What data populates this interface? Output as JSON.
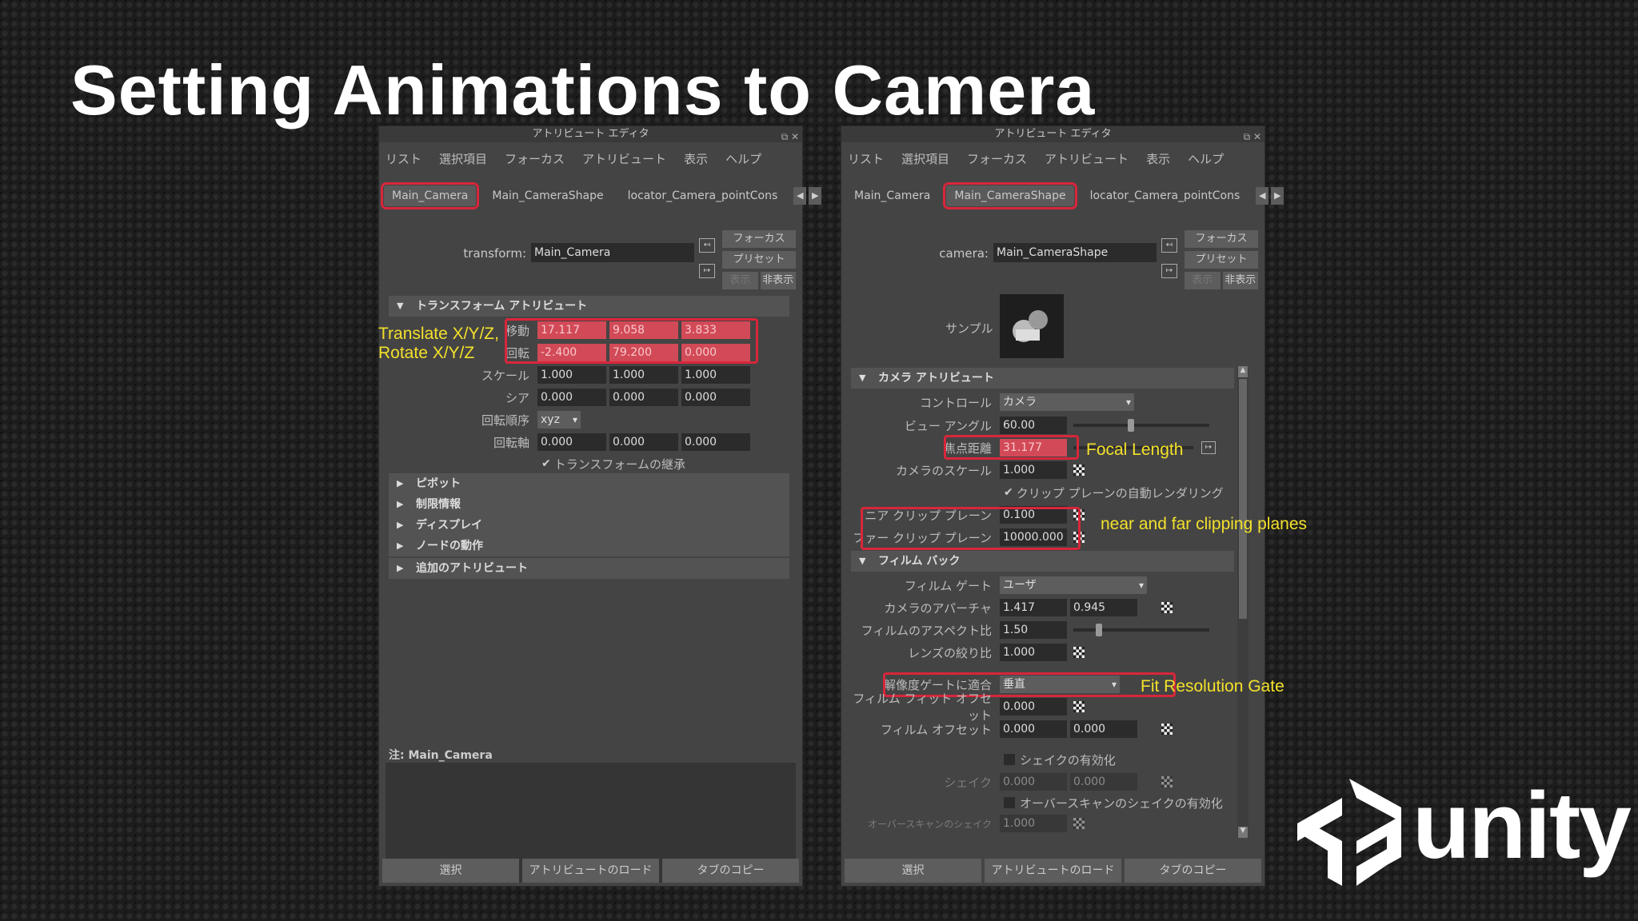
{
  "slide": {
    "title": "Setting Animations to Camera"
  },
  "left_editor": {
    "window_title": "アトリビュート エディタ",
    "menu": [
      "リスト",
      "選択項目",
      "フォーカス",
      "アトリビュート",
      "表示",
      "ヘルプ"
    ],
    "tabs": [
      "Main_Camera",
      "Main_CameraShape",
      "locator_Camera_pointCons"
    ],
    "node_type_label": "transform:",
    "node_name": "Main_Camera",
    "side_buttons": {
      "focus": "フォーカス",
      "preset": "プリセット",
      "show": "表示",
      "hide": "非表示"
    },
    "section_title": "トランスフォーム アトリビュート",
    "rows": [
      {
        "label": "移動",
        "values": [
          "17.117",
          "9.058",
          "3.833"
        ]
      },
      {
        "label": "回転",
        "values": [
          "-2.400",
          "79.200",
          "0.000"
        ]
      },
      {
        "label": "スケール",
        "values": [
          "1.000",
          "1.000",
          "1.000"
        ]
      },
      {
        "label": "シア",
        "values": [
          "0.000",
          "0.000",
          "0.000"
        ]
      },
      {
        "label": "回転順序",
        "values": [
          "xyz"
        ]
      },
      {
        "label": "回転軸",
        "values": [
          "0.000",
          "0.000",
          "0.000"
        ]
      }
    ],
    "inherit_label": "トランスフォームの継承",
    "collapsed_sections": [
      "ピボット",
      "制限情報",
      "ディスプレイ",
      "ノードの動作",
      "追加のアトリビュート"
    ],
    "note_label": "注:  Main_Camera",
    "bottom_buttons": [
      "選択",
      "アトリビュートのロード",
      "タブのコピー"
    ]
  },
  "right_editor": {
    "window_title": "アトリビュート エディタ",
    "menu": [
      "リスト",
      "選択項目",
      "フォーカス",
      "アトリビュート",
      "表示",
      "ヘルプ"
    ],
    "tabs": [
      "Main_Camera",
      "Main_CameraShape",
      "locator_Camera_pointCons"
    ],
    "node_type_label": "camera:",
    "node_name": "Main_CameraShape",
    "side_buttons": {
      "focus": "フォーカス",
      "preset": "プリセット",
      "show": "表示",
      "hide": "非表示"
    },
    "sample_label": "サンプル",
    "camera_section": "カメラ アトリビュート",
    "control_label": "コントロール",
    "control_value": "カメラ",
    "view_angle_label": "ビュー アングル",
    "view_angle_value": "60.00",
    "focal_length_label": "焦点距離",
    "focal_length_value": "31.177",
    "camera_scale_label": "カメラのスケール",
    "camera_scale_value": "1.000",
    "auto_clip_label": "クリップ プレーンの自動レンダリング",
    "near_clip_label": "ニア クリップ プレーン",
    "near_clip_value": "0.100",
    "far_clip_label": "ファー クリップ プレーン",
    "far_clip_value": "10000.000",
    "film_back_section": "フィルム バック",
    "film_gate_label": "フィルム ゲート",
    "film_gate_value": "ユーザ",
    "aperture_label": "カメラのアパーチャ",
    "aperture_values": [
      "1.417",
      "0.945"
    ],
    "film_aspect_label": "フィルムのアスペクト比",
    "film_aspect_value": "1.50",
    "lens_squeeze_label": "レンズの絞り比",
    "lens_squeeze_value": "1.000",
    "fit_gate_label": "解像度ゲートに適合",
    "fit_gate_value": "垂直",
    "film_fit_offset_label": "フィルム フィット オフセット",
    "film_fit_offset_value": "0.000",
    "film_offset_label": "フィルム オフセット",
    "film_offset_values": [
      "0.000",
      "0.000"
    ],
    "shake_enable_label": "シェイクの有効化",
    "shake_label": "シェイク",
    "shake_values": [
      "0.000",
      "0.000"
    ],
    "overscan_shake_label": "オーバースキャンのシェイクの有効化",
    "overscan_label": "オーバースキャンのシェイク",
    "overscan_value": "1.000",
    "bottom_buttons": [
      "選択",
      "アトリビュートのロード",
      "タブのコピー"
    ]
  },
  "annotations": {
    "translate_rotate": "Translate X/Y/Z,",
    "translate_rotate_2": "Rotate X/Y/Z",
    "focal_length": "Focal Length",
    "clip_planes": "near and far clipping planes",
    "fit_gate": "Fit Resolution Gate"
  },
  "logo": {
    "text": "unity"
  },
  "colors": {
    "highlight": "#d8263a",
    "annotation": "#f3e12b",
    "red_field": "#d24a57"
  }
}
